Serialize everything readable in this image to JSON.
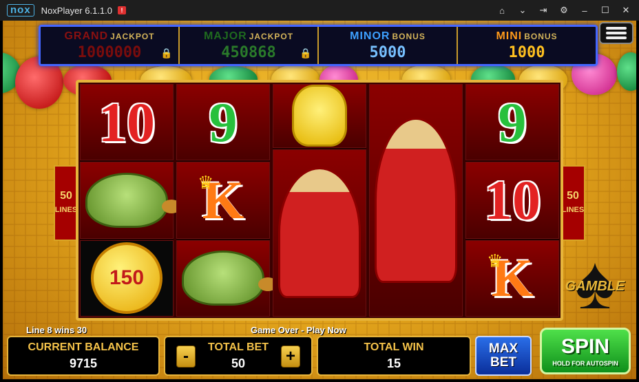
{
  "window": {
    "logo": "nox",
    "title": "NoxPlayer 6.1.1.0",
    "alert": "!",
    "controls": [
      "home-icon",
      "chevron-down-icon",
      "pin-icon",
      "gear-icon",
      "minimize-icon",
      "maximize-icon",
      "close-icon"
    ]
  },
  "jackpots": {
    "grand": {
      "label": "GRAND",
      "sub": "JACKPOT",
      "value": "1000000",
      "locked": true
    },
    "major": {
      "label": "MAJOR",
      "sub": "JACKPOT",
      "value": "450868",
      "locked": true
    },
    "minor": {
      "label": "MINOR",
      "sub": "BONUS",
      "value": "5000"
    },
    "mini": {
      "label": "MINI",
      "sub": "BONUS",
      "value": "1000"
    }
  },
  "reels": [
    [
      "10",
      "turtle",
      "150"
    ],
    [
      "9",
      "K",
      "turtle"
    ],
    [
      "cat",
      "god",
      "god"
    ],
    [
      "god",
      "god",
      "god"
    ],
    [
      "9",
      "10",
      "K"
    ]
  ],
  "lines": {
    "count": "50",
    "label": "LINES"
  },
  "gamble": "GAMBLE",
  "status": {
    "line_win": "Line 8 wins 30",
    "message": "Game Over - Play Now"
  },
  "balance": {
    "label": "CURRENT BALANCE",
    "value": "9715"
  },
  "bet": {
    "label": "TOTAL BET",
    "value": "50",
    "minus": "-",
    "plus": "+"
  },
  "win": {
    "label": "TOTAL WIN",
    "value": "15"
  },
  "max_bet": {
    "line1": "MAX",
    "line2": "BET"
  },
  "spin": {
    "label": "SPIN",
    "sub": "HOLD FOR AUTOSPIN"
  },
  "colors": {
    "accent": "#e6b43b",
    "reel_red": "#8b0000",
    "spin_green": "#1faa2a",
    "maxbet_blue": "#1a4fd0"
  }
}
